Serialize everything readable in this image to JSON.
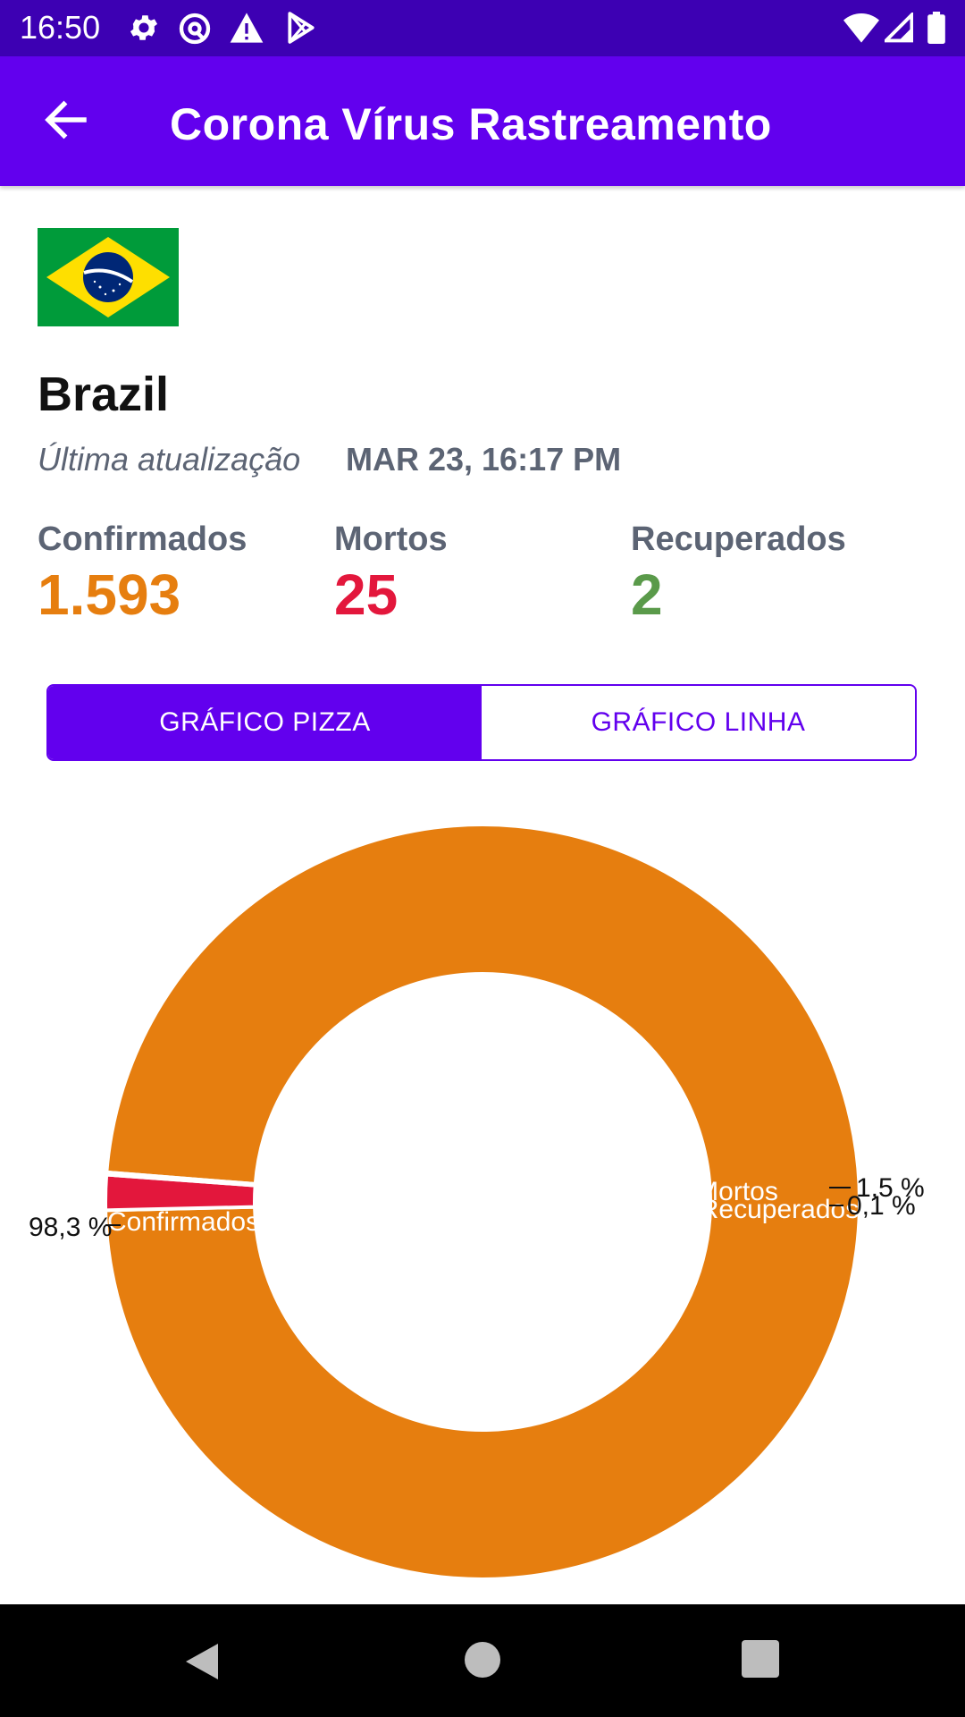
{
  "status_bar": {
    "time": "16:50",
    "left_icons": [
      "gear-icon",
      "at-sign-icon",
      "warning-icon",
      "play-store-icon"
    ],
    "right_icons": [
      "wifi-icon",
      "signal-icon",
      "battery-icon"
    ]
  },
  "app_bar": {
    "title": "Corona Vírus Rastreamento",
    "back_icon": "arrow-left-icon"
  },
  "country": {
    "name": "Brazil",
    "flag_icon": "brazil-flag-icon",
    "updated_label": "Última atualização",
    "updated_value": "MAR 23, 16:17 PM"
  },
  "stats": {
    "confirmed": {
      "label": "Confirmados",
      "value": "1.593",
      "color": "#e67e0f"
    },
    "deaths": {
      "label": "Mortos",
      "value": "25",
      "color": "#e3173c"
    },
    "recovered": {
      "label": "Recuperados",
      "value": "2",
      "color": "#5a9a4a"
    }
  },
  "toggle": {
    "pie_label": "GRÁFICO PIZZA",
    "line_label": "GRÁFICO LINHA",
    "selected": "pie"
  },
  "chart_data": {
    "type": "pie",
    "categories": [
      "Confirmados",
      "Mortos",
      "Recuperados"
    ],
    "values": [
      98.3,
      1.5,
      0.1
    ],
    "value_labels": [
      "98,3 %",
      "1,5 %",
      "0,1 %"
    ],
    "colors": [
      "#e67e0f",
      "#e3173c",
      "#5a9a4a"
    ],
    "donut": true
  },
  "colors": {
    "primary": "#6200ee",
    "status_bar": "#3d00b3"
  }
}
